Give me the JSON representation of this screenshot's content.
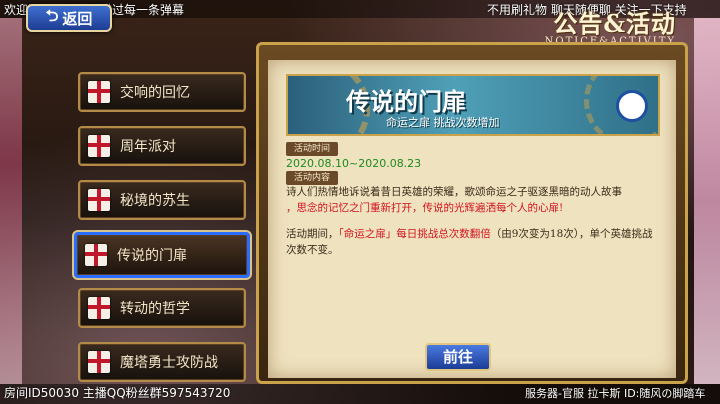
{
  "overlay": {
    "danmaku_left": "欢迎进入房间，不错过每一条弹幕",
    "danmaku_right": "不用刷礼物 聊天随便聊 关注一下支持",
    "room_info": "房间ID50030 主播QQ粉丝群597543720",
    "server_info": "服务器-官服 拉卡斯 ID:随风の脚踏车"
  },
  "header": {
    "back_label": "返回",
    "title": "公告&活动",
    "subtitle": "NOTICE&ACTIVITY"
  },
  "menu": {
    "items": [
      {
        "label": "交响的回忆"
      },
      {
        "label": "周年派对"
      },
      {
        "label": "秘境的苏生"
      },
      {
        "label": "传说的门扉",
        "selected": true
      },
      {
        "label": "转动的哲学"
      },
      {
        "label": "魔塔勇士攻防战"
      }
    ]
  },
  "notice": {
    "banner_title": "传说的门扉",
    "banner_subtitle": "命运之扉 挑战次数增加",
    "time_tag": "活动时间",
    "date_range": "2020.08.10~2020.08.23",
    "content_tag": "活动内容",
    "desc_line1": "诗人们热情地诉说着昔日英雄的荣耀，歌颂命运之子驱逐黑暗的动人故事",
    "desc_line2": "，思念的记忆之门重新打开，传说的光辉遍洒每个人的心扉!",
    "detail_prefix": "活动期间，",
    "detail_highlight": "「命运之扉」每日挑战总次数翻倍",
    "detail_suffix": "（由9次变为18次），单个英雄挑战次数不变。",
    "go_label": "前往"
  },
  "colors": {
    "selected_border": "#2a6cff",
    "date_green": "#1f8a1f",
    "highlight_red": "#d2141e"
  }
}
